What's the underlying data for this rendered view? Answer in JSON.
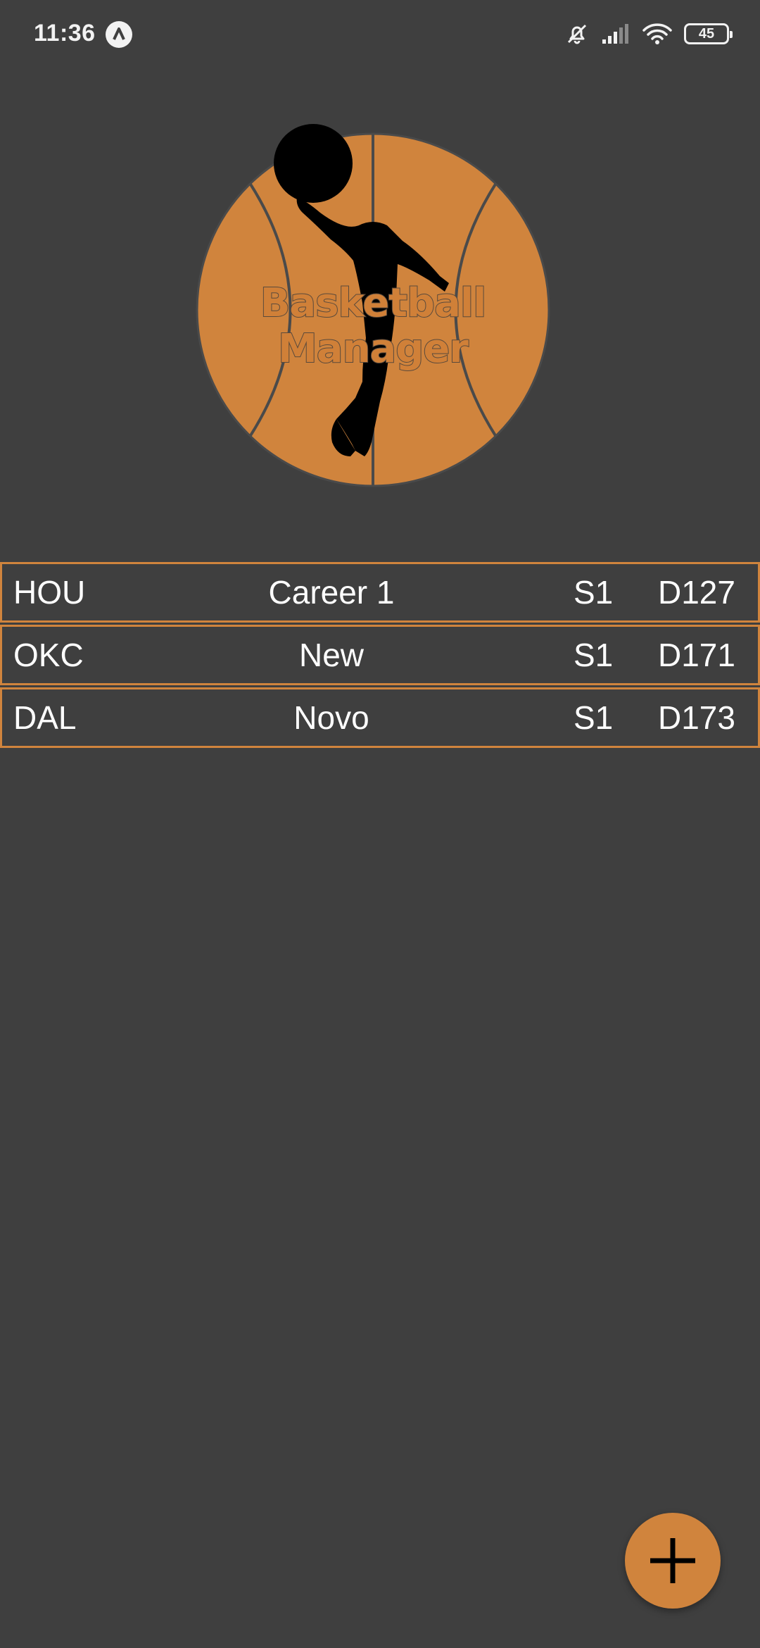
{
  "status_bar": {
    "time": "11:36",
    "battery_level": "45",
    "icons": [
      "app-notification-icon",
      "mute-icon",
      "signal-icon",
      "wifi-icon",
      "battery-icon"
    ]
  },
  "logo": {
    "title": "Basketball Manager",
    "ball_color": "#d0843d",
    "icon": "basketball-player-icon"
  },
  "saves": [
    {
      "team": "HOU",
      "name": "Career 1",
      "season": "S1",
      "day": "D127"
    },
    {
      "team": "OKC",
      "name": "New",
      "season": "S1",
      "day": "D171"
    },
    {
      "team": "DAL",
      "name": "Novo",
      "season": "S1",
      "day": "D173"
    }
  ],
  "fab": {
    "icon": "plus-icon",
    "color": "#d0843d"
  },
  "colors": {
    "background": "#3f3f3f",
    "accent": "#d0843d"
  }
}
